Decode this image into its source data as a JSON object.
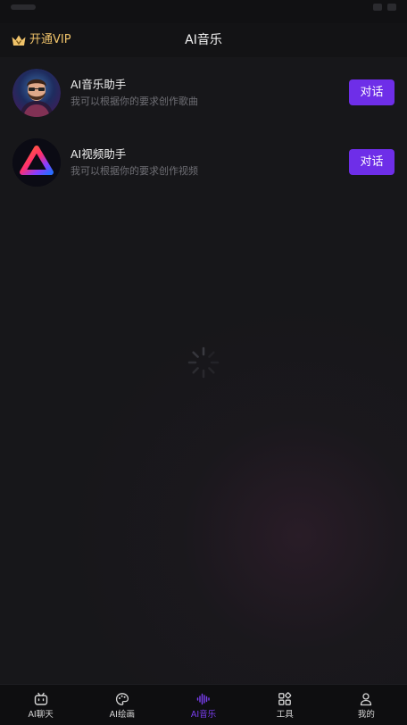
{
  "header": {
    "vip_label": "开通VIP",
    "title": "AI音乐",
    "vip_color": "#f0c36a"
  },
  "assistants": [
    {
      "name": "AI音乐助手",
      "description": "我可以根据你的要求创作歌曲",
      "button_label": "对话",
      "avatar_icon": "bearded-man-avatar-icon"
    },
    {
      "name": "AI视频助手",
      "description": "我可以根据你的要求创作视频",
      "button_label": "对话",
      "avatar_icon": "gradient-triangle-avatar-icon"
    }
  ],
  "tabs": [
    {
      "label": "AI聊天",
      "icon": "chat-robot-icon",
      "active": false
    },
    {
      "label": "AI绘画",
      "icon": "palette-icon",
      "active": false
    },
    {
      "label": "AI音乐",
      "icon": "sound-wave-icon",
      "active": true
    },
    {
      "label": "工具",
      "icon": "grid-apps-icon",
      "active": false
    },
    {
      "label": "我的",
      "icon": "user-profile-icon",
      "active": false
    }
  ],
  "colors": {
    "accent": "#6e2ee8",
    "active_tab": "#7b3ff2",
    "background": "#17171a",
    "secondary_text": "#6e6e74"
  }
}
